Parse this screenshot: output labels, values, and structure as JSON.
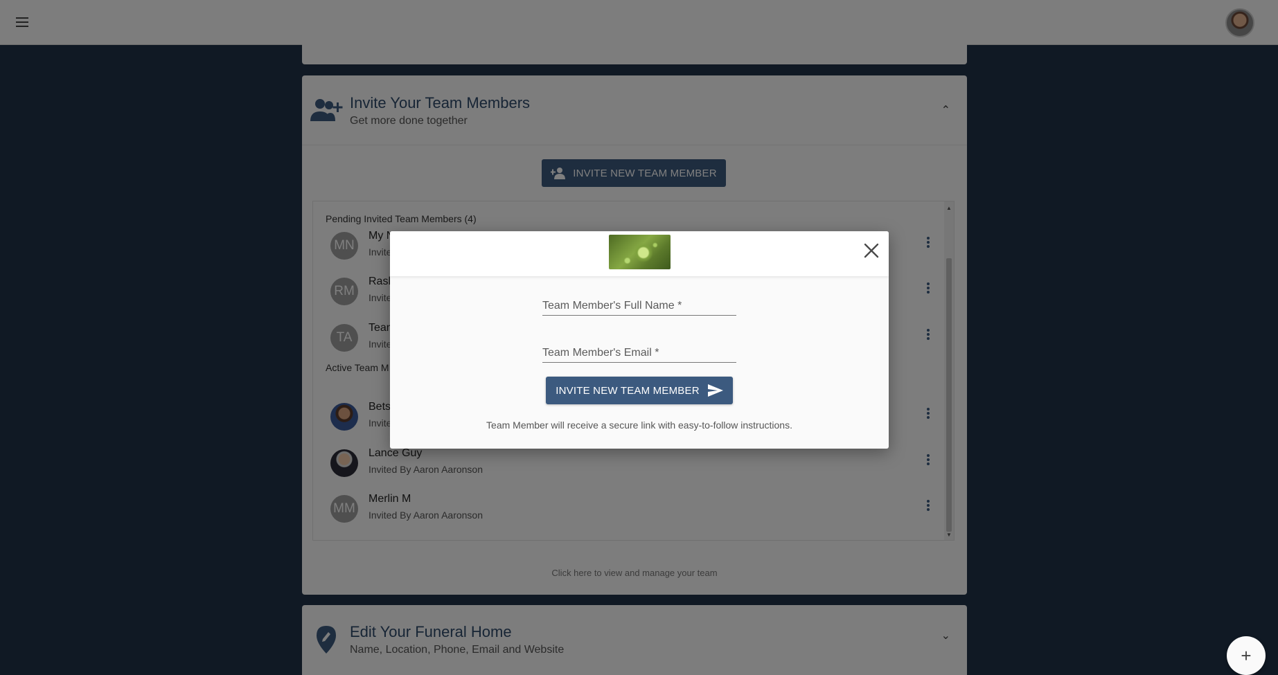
{
  "topbar": {
    "menu_icon": "hamburger-icon",
    "logo_icon": "water-droplet-leaf-logo",
    "avatar_icon": "user-avatar"
  },
  "team_card": {
    "title": "Invite Your Team Members",
    "subtitle": "Get more done together",
    "invite_button": "INVITE NEW TEAM MEMBER",
    "pending_label": "Pending Invited Team Members (4)",
    "pending": [
      {
        "initials": "MN",
        "name": "My N",
        "sub": "Invite"
      },
      {
        "initials": "RM",
        "name": "Rash",
        "sub": "Invite"
      },
      {
        "initials": "TA",
        "name": "Tean",
        "sub": "Invite"
      }
    ],
    "active_label": "Active Team M",
    "active": [
      {
        "initials": "",
        "name": "Bets",
        "sub": "Invite"
      },
      {
        "initials": "",
        "name": "Lance Guy",
        "sub": "Invited By Aaron Aaronson"
      },
      {
        "initials": "MM",
        "name": "Merlin M",
        "sub": "Invited By Aaron Aaronson"
      }
    ],
    "manage_link": "Click here to view and manage your team"
  },
  "edit_card": {
    "title": "Edit Your Funeral Home",
    "subtitle": "Name, Location, Phone, Email and Website"
  },
  "modal": {
    "name_placeholder": "Team Member's Full Name *",
    "email_placeholder": "Team Member's Email *",
    "submit_label": "INVITE NEW TEAM MEMBER",
    "note": "Team Member will receive a secure link with easy-to-follow instructions."
  },
  "fab": {
    "label": "+"
  },
  "colors": {
    "primary": "#3c5a7f",
    "background": "#213249",
    "card": "#fafafa"
  }
}
